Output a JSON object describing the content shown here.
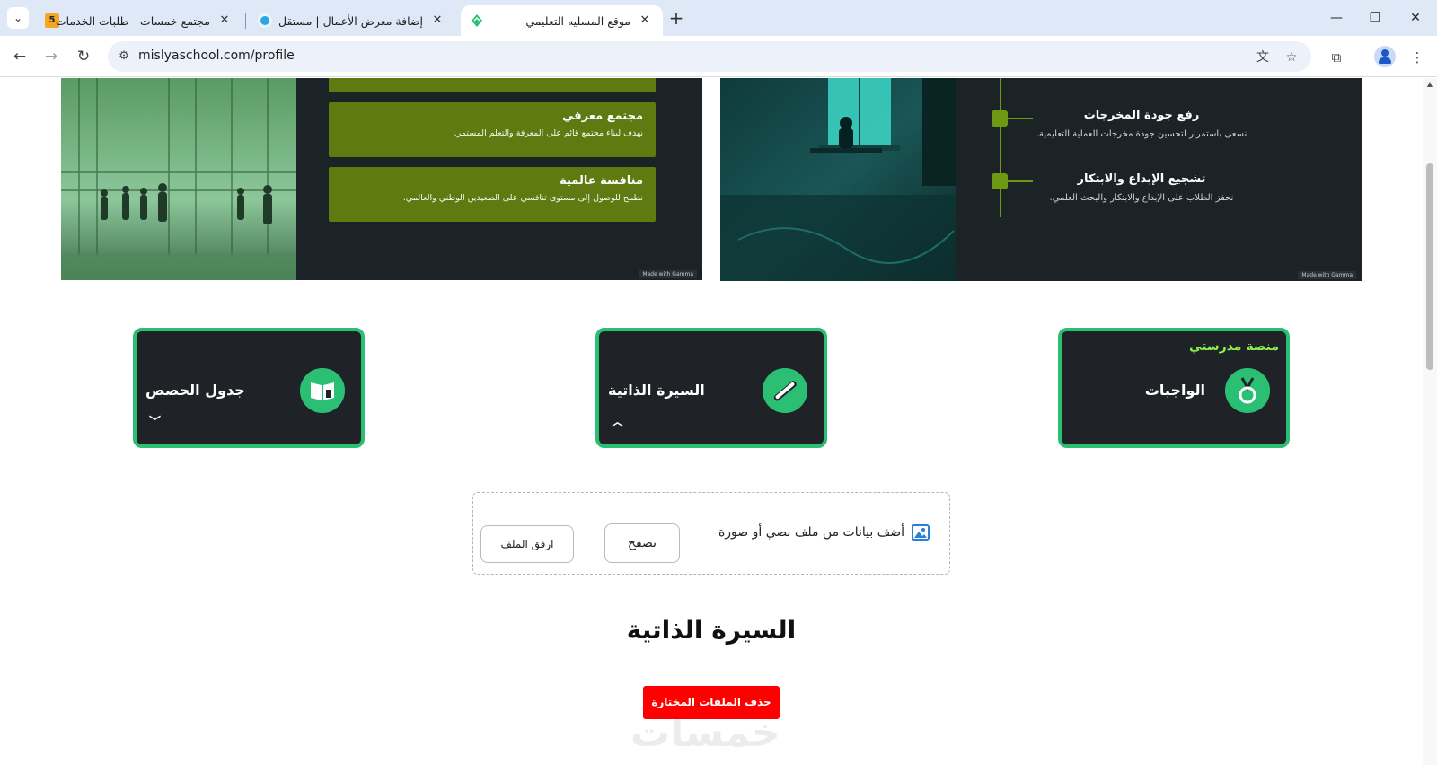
{
  "browser": {
    "tabs": [
      {
        "title": "مجتمع خمسات - طلبات الخدمات",
        "favicon": "khamsat-5",
        "active": false
      },
      {
        "title": "إضافة معرض الأعمال | مستقل",
        "favicon": "mostaql-circle",
        "active": false
      },
      {
        "title": "موقع المسليه التعليمي",
        "favicon": "leaf",
        "active": true
      }
    ],
    "favicon_badge": "5",
    "url": "mislyaschool.com/profile",
    "window": {
      "minimize": "—",
      "restore": "❐",
      "close": "✕"
    }
  },
  "slides": {
    "left": {
      "cards": [
        {
          "heading": "مجتمع معرفي",
          "text": "نهدف لبناء مجتمع قائم على المعرفة والتعلم المستمر."
        },
        {
          "heading": "منافسة عالمية",
          "text": "نطمح للوصول إلى مستوى تنافسي على الصعيدين الوطني والعالمي."
        }
      ],
      "badge": "Made with Gamma"
    },
    "right": {
      "items": [
        {
          "heading": "رفع جودة المخرجات",
          "text": "نسعى باستمرار لتحسين جودة مخرجات العملية التعليمية."
        },
        {
          "heading": "تشجيع الإبداع والابتكار",
          "text": "نحفز الطلاب على الإبداع والابتكار والبحث العلمي."
        }
      ],
      "badge": "Made with Gamma"
    }
  },
  "features": [
    {
      "label": "الواجبات",
      "brand": "منصة مدرستي",
      "icon": "medal-icon",
      "chevron": ""
    },
    {
      "label": "السيرة الذاتية",
      "brand": "",
      "icon": "certificate-scroll-icon",
      "chevron": "^"
    },
    {
      "label": "جدول الحصص",
      "brand": "",
      "icon": "book-schedule-icon",
      "chevron": "v"
    }
  ],
  "upload": {
    "prompt": "أضف بيانات من ملف نصي أو صورة",
    "browse_label": "تصفح",
    "attach_label": "ارفق الملف"
  },
  "cv_section": {
    "title": "السيرة الذاتية",
    "delete_label": "حذف الملفات المختارة"
  },
  "watermark": "خمسات",
  "colors": {
    "accent_green": "#2bbf74",
    "card_bg": "#1f2328",
    "brand_lime": "#8ef04f",
    "danger": "#ff0000"
  }
}
